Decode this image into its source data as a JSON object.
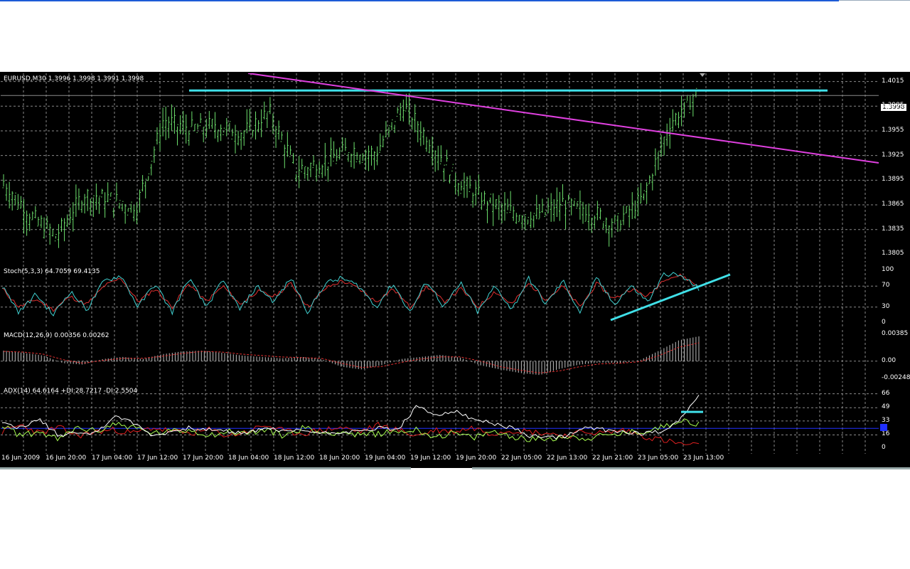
{
  "window": {
    "symbol_header": "EURUSD,M30  1.3996 1.3998 1.3991 1.3998"
  },
  "price_tag": "1.3998",
  "panes": {
    "price": {
      "ticks": [
        "1.4015",
        "1.3985",
        "1.3955",
        "1.3925",
        "1.3895",
        "1.3865",
        "1.3835",
        "1.3805"
      ]
    },
    "stoch": {
      "header": "Stoch(5,3,3) 64.7059 69.4135",
      "ticks": [
        "100",
        "70",
        "30",
        "0"
      ]
    },
    "macd": {
      "header": "MACD(12,26,9) 0.00356 0.00262",
      "ticks": [
        "0.00385",
        "0.00",
        "-0.00248"
      ]
    },
    "adx": {
      "header": "ADX(14) 64.6164 +DI:28.7217 -DI:2.5504",
      "ticks": [
        "66",
        "49",
        "33",
        "16",
        "0"
      ]
    }
  },
  "time_labels": [
    "16 Jun 2009",
    "16 Jun 20:00",
    "17 Jun 04:00",
    "17 Jun 12:00",
    "17 Jun 20:00",
    "18 Jun 04:00",
    "18 Jun 12:00",
    "18 Jun 20:00",
    "19 Jun 04:00",
    "19 Jun 12:00",
    "19 Jun 20:00",
    "22 Jun 05:00",
    "22 Jun 13:00",
    "22 Jun 21:00",
    "23 Jun 05:00",
    "23 Jun 13:00"
  ],
  "colors": {
    "bars": "#6de06d",
    "stoch_main": "#40d0d0",
    "stoch_signal": "#e03030",
    "macd_hist": "#c0c0c0",
    "macd_signal": "#e03030",
    "adx": "#ffffff",
    "plus_di": "#a8ff50",
    "minus_di": "#e02020",
    "trend_magenta": "#e040e0",
    "trend_cyan": "#40e0e8",
    "level_blue": "#2030ff",
    "grid": "#8a8a8a"
  },
  "chart_data": [
    {
      "type": "ohlc",
      "title": "EURUSD,M30",
      "ylim": [
        1.3795,
        1.4025
      ],
      "x": [
        "16 Jun 2009",
        "16 Jun 20:00",
        "17 Jun 04:00",
        "17 Jun 12:00",
        "17 Jun 20:00",
        "18 Jun 04:00",
        "18 Jun 12:00",
        "18 Jun 20:00",
        "19 Jun 04:00",
        "19 Jun 12:00",
        "19 Jun 20:00",
        "22 Jun 05:00",
        "22 Jun 13:00",
        "22 Jun 21:00",
        "23 Jun 05:00",
        "23 Jun 13:00"
      ],
      "series": [
        {
          "values": [
            1.389,
            1.385,
            1.3825,
            1.3875,
            1.387,
            1.386,
            1.3965,
            1.3955,
            1.396,
            1.395,
            1.3975,
            1.3905,
            1.3915,
            1.393,
            1.3925,
            1.3985,
            1.394,
            1.3895,
            1.387,
            1.3855,
            1.385,
            1.3865,
            1.3855,
            1.384,
            1.387,
            1.396,
            1.3998
          ]
        }
      ],
      "last": {
        "open": 1.3996,
        "high": 1.3998,
        "low": 1.3991,
        "close": 1.3998
      }
    },
    {
      "type": "line",
      "title": "Stoch(5,3,3)",
      "ylim": [
        0,
        100
      ],
      "series": [
        {
          "name": "main",
          "values": [
            70,
            20,
            55,
            15,
            60,
            25,
            80,
            90,
            30,
            75,
            20,
            85,
            30,
            80,
            25,
            70,
            40,
            85,
            20,
            75,
            85,
            70,
            30,
            75,
            20,
            80,
            30,
            75,
            20,
            70,
            25,
            85,
            35,
            80,
            20,
            85,
            35,
            70,
            40,
            95,
            88,
            65
          ]
        },
        {
          "name": "signal",
          "values": [
            65,
            30,
            45,
            25,
            50,
            35,
            70,
            85,
            40,
            65,
            30,
            75,
            40,
            70,
            35,
            60,
            50,
            75,
            30,
            65,
            80,
            65,
            40,
            65,
            30,
            70,
            40,
            65,
            30,
            60,
            35,
            75,
            45,
            70,
            30,
            75,
            45,
            65,
            50,
            85,
            90,
            69
          ]
        }
      ]
    },
    {
      "type": "bar",
      "title": "MACD(12,26,9)",
      "ylim": [
        -0.00248,
        0.00385
      ],
      "series": [
        {
          "name": "histogram",
          "values": [
            0.0015,
            0.0012,
            0.0008,
            -0.0003,
            -0.0005,
            0.0003,
            0.0006,
            0.0003,
            0.001,
            0.0014,
            0.0015,
            0.0012,
            0.0008,
            0.0006,
            0.0004,
            0.0006,
            0.0003,
            -0.0008,
            -0.0012,
            -0.0006,
            0.0003,
            0.0006,
            0.0009,
            0.0005,
            -0.0006,
            -0.0012,
            -0.0017,
            -0.002,
            -0.0011,
            -0.0005,
            -0.0002,
            -0.0003,
            0.0001,
            0.0015,
            0.003,
            0.00356
          ]
        },
        {
          "name": "signal",
          "values": [
            0.0014,
            0.0013,
            0.001,
            0.0002,
            -0.0003,
            0.0001,
            0.0004,
            0.0004,
            0.0007,
            0.0011,
            0.0014,
            0.0013,
            0.001,
            0.0008,
            0.0006,
            0.0005,
            0.0004,
            -0.0003,
            -0.0009,
            -0.0008,
            -0.0002,
            0.0003,
            0.0006,
            0.0006,
            0.0,
            -0.0008,
            -0.0013,
            -0.0017,
            -0.0014,
            -0.0008,
            -0.0004,
            -0.0003,
            -0.0001,
            0.0008,
            0.002,
            0.00262
          ]
        }
      ]
    },
    {
      "type": "line",
      "title": "ADX(14)",
      "ylim": [
        0,
        70
      ],
      "series": [
        {
          "name": "ADX",
          "values": [
            30,
            25,
            35,
            15,
            20,
            18,
            40,
            30,
            15,
            20,
            25,
            22,
            20,
            18,
            25,
            20,
            22,
            18,
            20,
            20,
            25,
            22,
            50,
            40,
            45,
            35,
            30,
            25,
            15,
            12,
            15,
            25,
            22,
            20,
            18,
            20,
            35,
            64.6164
          ]
        },
        {
          "name": "+DI",
          "values": [
            28,
            15,
            20,
            10,
            25,
            20,
            30,
            25,
            18,
            20,
            22,
            16,
            20,
            18,
            22,
            15,
            25,
            18,
            20,
            15,
            18,
            20,
            22,
            14,
            18,
            12,
            20,
            15,
            10,
            12,
            14,
            12,
            15,
            18,
            20,
            25,
            35,
            28.7217
          ]
        },
        {
          "name": "-DI",
          "values": [
            20,
            28,
            18,
            25,
            15,
            20,
            22,
            18,
            25,
            20,
            18,
            22,
            15,
            20,
            28,
            20,
            18,
            22,
            25,
            20,
            28,
            22,
            15,
            22,
            20,
            25,
            18,
            22,
            20,
            18,
            15,
            20,
            18,
            22,
            15,
            10,
            5,
            2.5504
          ]
        }
      ]
    }
  ]
}
